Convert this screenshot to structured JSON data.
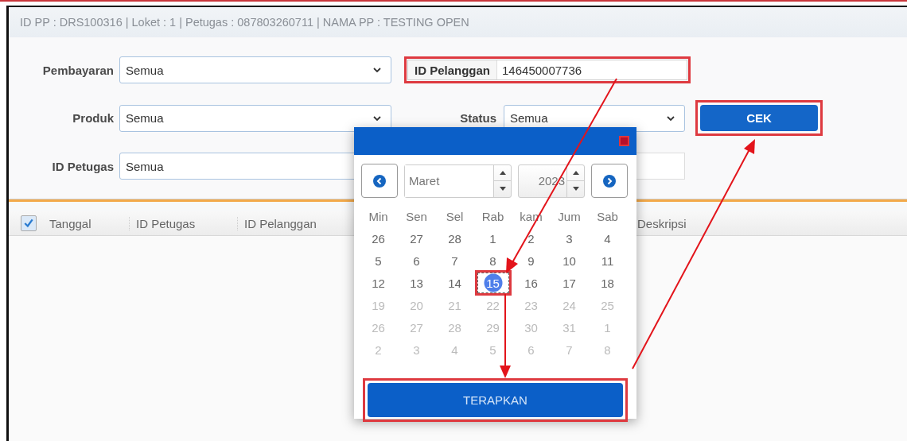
{
  "header": {
    "info": "ID PP : DRS100316 | Loket : 1 | Petugas : 087803260711 | NAMA PP : TESTING OPEN"
  },
  "filters": {
    "pembayaran": {
      "label": "Pembayaran",
      "value": "Semua"
    },
    "id_pelanggan": {
      "label": "ID Pelanggan",
      "value": "146450007736",
      "highlighted": true
    },
    "produk": {
      "label": "Produk",
      "value": "Semua"
    },
    "status": {
      "label": "Status",
      "value": "Semua"
    },
    "cek_button": {
      "label": "CEK",
      "highlighted": true
    },
    "id_petugas": {
      "label": "ID Petugas",
      "value": "Semua"
    }
  },
  "table": {
    "select_all_checked": true,
    "columns": [
      "Tanggal",
      "ID Petugas",
      "ID Pelanggan",
      "Deskripsi"
    ]
  },
  "calendar": {
    "month": "Maret",
    "year": "2023",
    "weekdays": [
      "Min",
      "Sen",
      "Sel",
      "Rab",
      "kam",
      "Jum",
      "Sab"
    ],
    "weeks": [
      [
        {
          "day": "26",
          "disabled": false,
          "selected": false
        },
        {
          "day": "27",
          "disabled": false,
          "selected": false
        },
        {
          "day": "28",
          "disabled": false,
          "selected": false
        },
        {
          "day": "1",
          "disabled": false,
          "selected": false
        },
        {
          "day": "2",
          "disabled": false,
          "selected": false
        },
        {
          "day": "3",
          "disabled": false,
          "selected": false
        },
        {
          "day": "4",
          "disabled": false,
          "selected": false
        }
      ],
      [
        {
          "day": "5",
          "disabled": false,
          "selected": false
        },
        {
          "day": "6",
          "disabled": false,
          "selected": false
        },
        {
          "day": "7",
          "disabled": false,
          "selected": false
        },
        {
          "day": "8",
          "disabled": false,
          "selected": false
        },
        {
          "day": "9",
          "disabled": false,
          "selected": false
        },
        {
          "day": "10",
          "disabled": false,
          "selected": false
        },
        {
          "day": "11",
          "disabled": false,
          "selected": false
        }
      ],
      [
        {
          "day": "12",
          "disabled": false,
          "selected": false
        },
        {
          "day": "13",
          "disabled": false,
          "selected": false
        },
        {
          "day": "14",
          "disabled": false,
          "selected": false
        },
        {
          "day": "15",
          "disabled": false,
          "selected": true
        },
        {
          "day": "16",
          "disabled": false,
          "selected": false
        },
        {
          "day": "17",
          "disabled": false,
          "selected": false
        },
        {
          "day": "18",
          "disabled": false,
          "selected": false
        }
      ],
      [
        {
          "day": "19",
          "disabled": true,
          "selected": false
        },
        {
          "day": "20",
          "disabled": true,
          "selected": false
        },
        {
          "day": "21",
          "disabled": true,
          "selected": false
        },
        {
          "day": "22",
          "disabled": true,
          "selected": false
        },
        {
          "day": "23",
          "disabled": true,
          "selected": false
        },
        {
          "day": "24",
          "disabled": true,
          "selected": false
        },
        {
          "day": "25",
          "disabled": true,
          "selected": false
        }
      ],
      [
        {
          "day": "26",
          "disabled": true,
          "selected": false
        },
        {
          "day": "27",
          "disabled": true,
          "selected": false
        },
        {
          "day": "28",
          "disabled": true,
          "selected": false
        },
        {
          "day": "29",
          "disabled": true,
          "selected": false
        },
        {
          "day": "30",
          "disabled": true,
          "selected": false
        },
        {
          "day": "31",
          "disabled": true,
          "selected": false
        },
        {
          "day": "1",
          "disabled": true,
          "selected": false
        }
      ],
      [
        {
          "day": "2",
          "disabled": true,
          "selected": false
        },
        {
          "day": "3",
          "disabled": true,
          "selected": false
        },
        {
          "day": "4",
          "disabled": true,
          "selected": false
        },
        {
          "day": "5",
          "disabled": true,
          "selected": false
        },
        {
          "day": "6",
          "disabled": true,
          "selected": false
        },
        {
          "day": "7",
          "disabled": true,
          "selected": false
        },
        {
          "day": "8",
          "disabled": true,
          "selected": false
        }
      ]
    ],
    "apply_button": {
      "label": "TERAPKAN",
      "highlighted": true
    }
  }
}
